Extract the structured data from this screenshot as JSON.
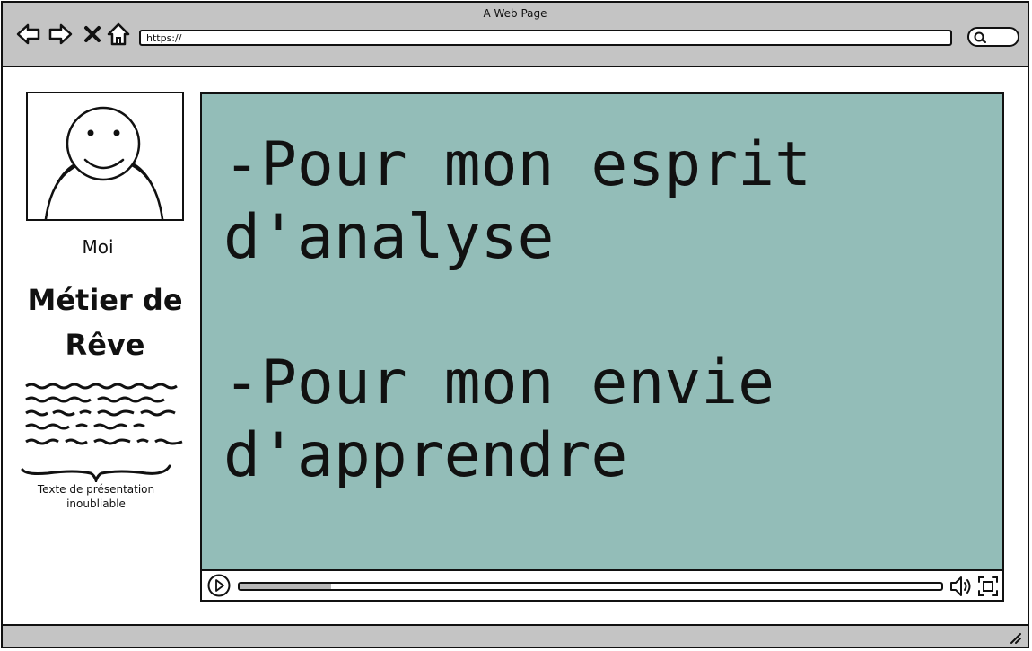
{
  "window": {
    "title": "A Web Page"
  },
  "browser": {
    "url_text": "https://",
    "nav": [
      "back-icon",
      "forward-icon",
      "close-icon",
      "home-icon"
    ],
    "search_icon": "search-icon"
  },
  "profile": {
    "avatar_icon": "person-avatar-icon",
    "name": "Moi",
    "heading_line1": "Métier de",
    "heading_line2": "Rêve",
    "caption_line1": "Texte de présentation",
    "caption_line2": "inoubliable"
  },
  "video": {
    "text": "-Pour mon esprit\nd'analyse\n\n-Pour mon envie\nd'apprendre",
    "background_color": "#93bdb8",
    "progress": 0.13,
    "controls": [
      "play-icon",
      "volume-icon",
      "fullscreen-icon"
    ]
  }
}
